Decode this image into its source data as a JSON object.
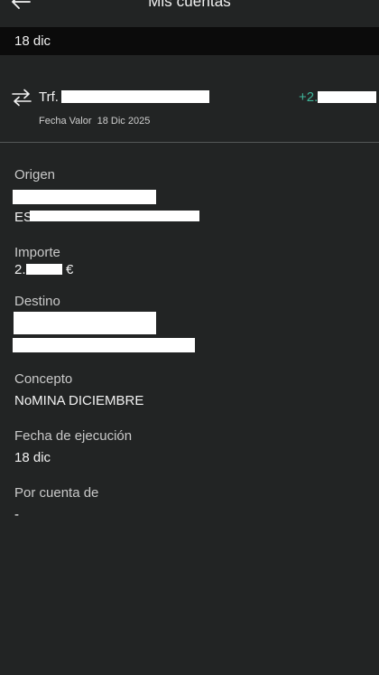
{
  "header": {
    "title": "Mis cuentas",
    "back_icon": "arrow-left-icon"
  },
  "date_bar": {
    "label": "18 dic"
  },
  "transaction": {
    "icon": "swap-arrows-icon",
    "name_prefix": "Trf.",
    "amount_prefix": "+2.",
    "value_date_label": "Fecha Valor",
    "value_date": "18 Dic 2025",
    "amount_color": "#3fb59a"
  },
  "details": {
    "origin": {
      "label": "Origen",
      "iban_prefix": "ES"
    },
    "amount": {
      "label": "Importe",
      "value_prefix": "2.",
      "currency": "€"
    },
    "destination": {
      "label": "Destino"
    },
    "concept": {
      "label": "Concepto",
      "value": "NoMINA DICIEMBRE"
    },
    "execution_date": {
      "label": "Fecha de ejecución",
      "value": "18 dic"
    },
    "on_behalf_of": {
      "label": "Por cuenta de",
      "value": "-"
    }
  }
}
